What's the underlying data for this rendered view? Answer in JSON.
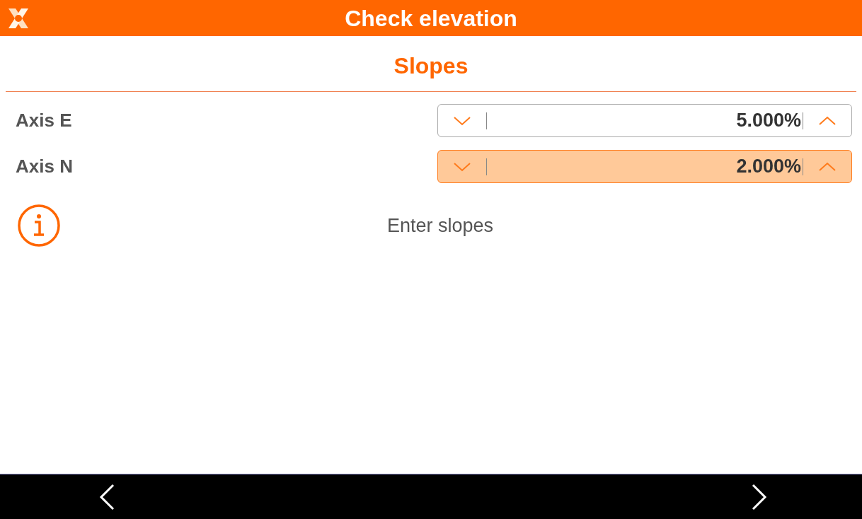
{
  "header": {
    "title": "Check elevation"
  },
  "section": {
    "title": "Slopes"
  },
  "fields": [
    {
      "label": "Axis E",
      "value": "5.000%",
      "focused": false
    },
    {
      "label": "Axis N",
      "value": "2.000%",
      "focused": true
    }
  ],
  "message": "Enter slopes"
}
